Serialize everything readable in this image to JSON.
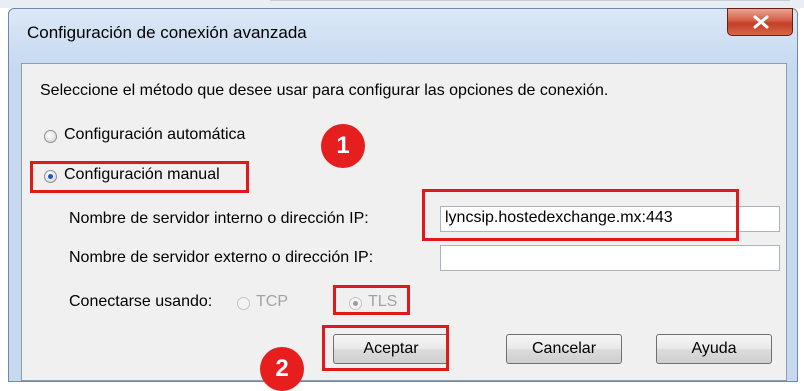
{
  "window": {
    "title": "Configuración de conexión avanzada",
    "close_glyph": "X"
  },
  "dialog": {
    "instruction": "Seleccione el método que desee usar para configurar las opciones de conexión.",
    "auto_label": "Configuración automática",
    "auto_selected": false,
    "manual_label": "Configuración manual",
    "manual_selected": true,
    "internal_label": "Nombre de servidor interno o dirección IP:",
    "internal_value": "lyncsip.hostedexchange.mx:443",
    "external_label": "Nombre de servidor externo o dirección IP:",
    "external_value": "",
    "connect_label": "Conectarse usando:",
    "tcp_label": "TCP",
    "tls_label": "TLS",
    "tls_selected": true
  },
  "buttons": {
    "accept": "Aceptar",
    "cancel": "Cancelar",
    "help": "Ayuda"
  },
  "annotations": {
    "badge1": "1",
    "badge2": "2",
    "highlight_color": "#e01a1a"
  }
}
